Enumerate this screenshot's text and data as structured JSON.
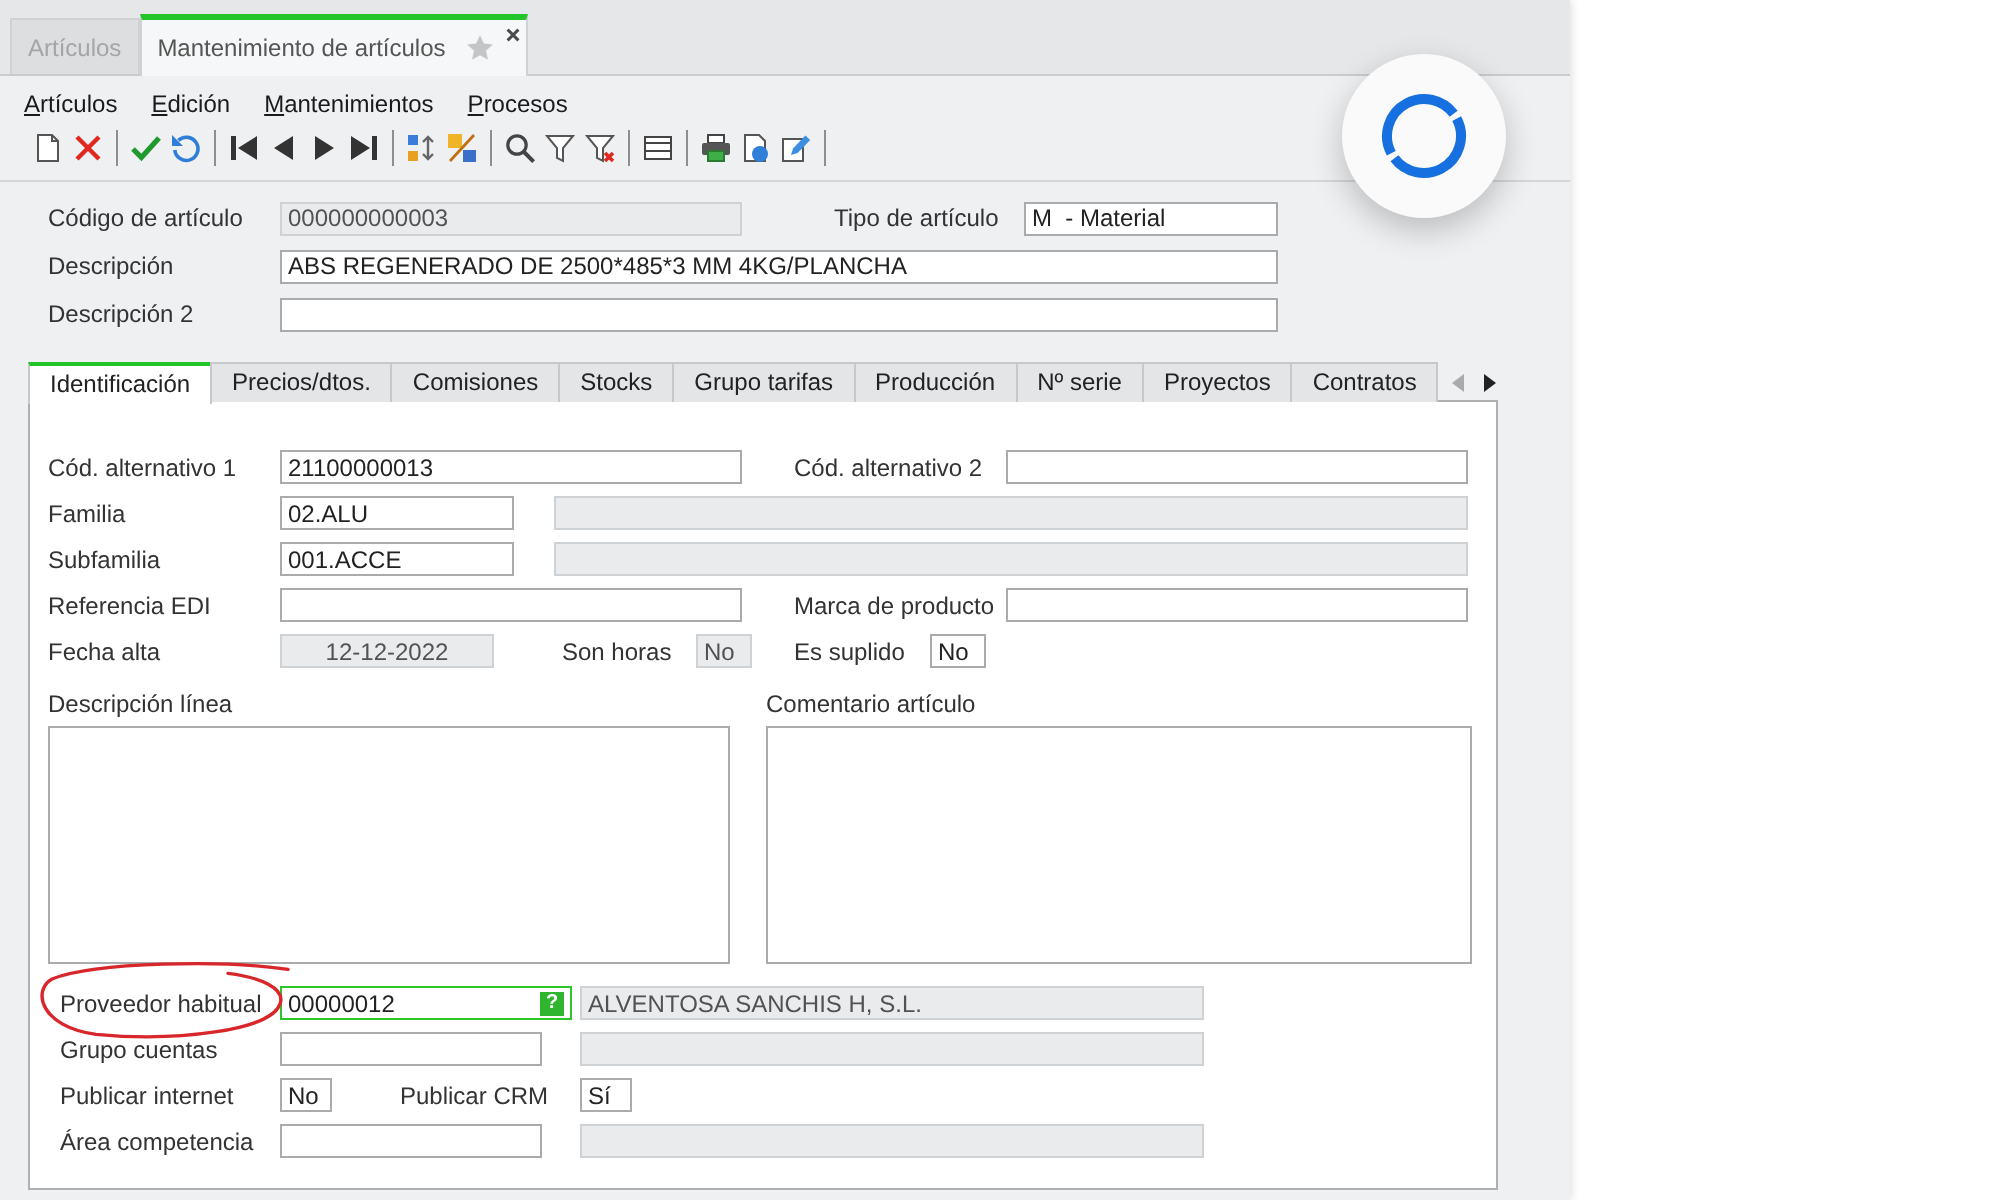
{
  "document_tabs": [
    {
      "label": "Artículos",
      "selected": false
    },
    {
      "label": "Mantenimiento de artículos",
      "selected": true,
      "favorite": false
    }
  ],
  "menu": [
    "Artículos",
    "Edición",
    "Mantenimientos",
    "Procesos"
  ],
  "toolbar": [
    {
      "kind": "new"
    },
    {
      "kind": "delete"
    },
    {
      "kind": "separator"
    },
    {
      "kind": "accept"
    },
    {
      "kind": "undo"
    },
    {
      "kind": "separator"
    },
    {
      "kind": "first"
    },
    {
      "kind": "previous"
    },
    {
      "kind": "next"
    },
    {
      "kind": "last"
    },
    {
      "kind": "separator"
    },
    {
      "kind": "sort"
    },
    {
      "kind": "sort_numeric"
    },
    {
      "kind": "separator"
    },
    {
      "kind": "search"
    },
    {
      "kind": "filter"
    },
    {
      "kind": "clear_filter"
    },
    {
      "kind": "separator"
    },
    {
      "kind": "table"
    },
    {
      "kind": "separator"
    },
    {
      "kind": "print"
    },
    {
      "kind": "preview"
    },
    {
      "kind": "edit"
    },
    {
      "kind": "separator"
    }
  ],
  "header": {
    "rows": [
      [
        {
          "label": "Código de artículo",
          "kind": "text",
          "value": "000000000003",
          "readonly": true,
          "focused": false
        },
        {
          "label": "Tipo de artículo",
          "kind": "medium",
          "value": "M  - Material",
          "readonly": false,
          "focused": false
        }
      ],
      [
        {
          "label": "Descripción",
          "kind": "long",
          "value": "ABS REGENERADO DE 2500*485*3 MM 4KG/PLANCHA",
          "readonly": false,
          "focused": false
        }
      ],
      [
        {
          "label": "Descripción 2",
          "kind": "long",
          "readonly": false,
          "focused": false
        }
      ]
    ]
  },
  "tabs": [
    {
      "label": "Identificación",
      "selected": true
    },
    {
      "label": "Precios/dtos.",
      "selected": false
    },
    {
      "label": "Comisiones",
      "selected": false
    },
    {
      "label": "Stocks",
      "selected": false
    },
    {
      "label": "Grupo tarifas",
      "selected": false
    },
    {
      "label": "Producción",
      "selected": false
    },
    {
      "label": "Nº serie",
      "selected": false
    },
    {
      "label": "Proyectos",
      "selected": false
    },
    {
      "label": "Contratos",
      "selected": false
    }
  ],
  "tab_scroll": {
    "back_enabled": false,
    "forward_enabled": true
  },
  "panel": {
    "rows": [
      [
        {
          "label": "Cód. alternativo 1",
          "kind": "text",
          "value": "21100000013",
          "readonly": false,
          "focused": false,
          "circled": false
        },
        {
          "label": "Cód. alternativo 2",
          "kind": "text",
          "readonly": false,
          "focused": false,
          "circled": false
        }
      ],
      [
        {
          "label": "Familia",
          "kind": "code",
          "value": "02.ALU",
          "readonly": false,
          "focused": false,
          "circled": false
        },
        {
          "kind": "description",
          "readonly": true,
          "focused": false,
          "circled": false
        }
      ],
      [
        {
          "label": "Subfamilia",
          "kind": "code",
          "value": "001.ACCE",
          "readonly": false,
          "focused": false,
          "circled": false
        },
        {
          "kind": "description",
          "readonly": true,
          "focused": false,
          "circled": false
        }
      ],
      [
        {
          "label": "Referencia EDI",
          "kind": "text",
          "readonly": false,
          "focused": false,
          "circled": false
        },
        {
          "label": "Marca de producto",
          "kind": "text",
          "readonly": false,
          "focused": false,
          "circled": false
        }
      ],
      [
        {
          "label": "Fecha alta",
          "kind": "date",
          "value": "12-12-2022",
          "readonly": true,
          "focused": false,
          "circled": false
        },
        {
          "label": "Son horas",
          "kind": "flag",
          "value": "No",
          "readonly": true,
          "focused": false,
          "circled": false
        },
        {
          "label": "Es suplido",
          "kind": "flag",
          "value": "No",
          "readonly": false,
          "focused": false,
          "circled": false
        }
      ]
    ],
    "memos": [
      {
        "label": "Descripción línea"
      },
      {
        "label": "Comentario artículo"
      }
    ],
    "lower_rows": [
      [
        {
          "label": "Proveedor habitual",
          "kind": "code",
          "value": "00000012",
          "readonly": false,
          "focused": true,
          "circled": true,
          "lookup": "?"
        },
        {
          "kind": "description",
          "value": "ALVENTOSA SANCHIS H, S.L.",
          "readonly": true,
          "focused": false,
          "circled": false
        }
      ],
      [
        {
          "label": "Grupo cuentas",
          "kind": "code",
          "readonly": false,
          "focused": false,
          "circled": false
        },
        {
          "kind": "description",
          "readonly": true,
          "focused": false,
          "circled": false
        }
      ],
      [
        {
          "label": "Publicar internet",
          "kind": "flag",
          "value": "No",
          "readonly": false,
          "focused": false,
          "circled": false
        },
        {
          "label": "Publicar CRM",
          "kind": "flag",
          "value": "Sí",
          "readonly": false,
          "focused": false,
          "circled": false
        }
      ],
      [
        {
          "label": "Área competencia",
          "kind": "code",
          "readonly": false,
          "focused": false,
          "circled": false
        },
        {
          "kind": "description",
          "readonly": true,
          "focused": false,
          "circled": false
        }
      ]
    ]
  },
  "busy": true
}
